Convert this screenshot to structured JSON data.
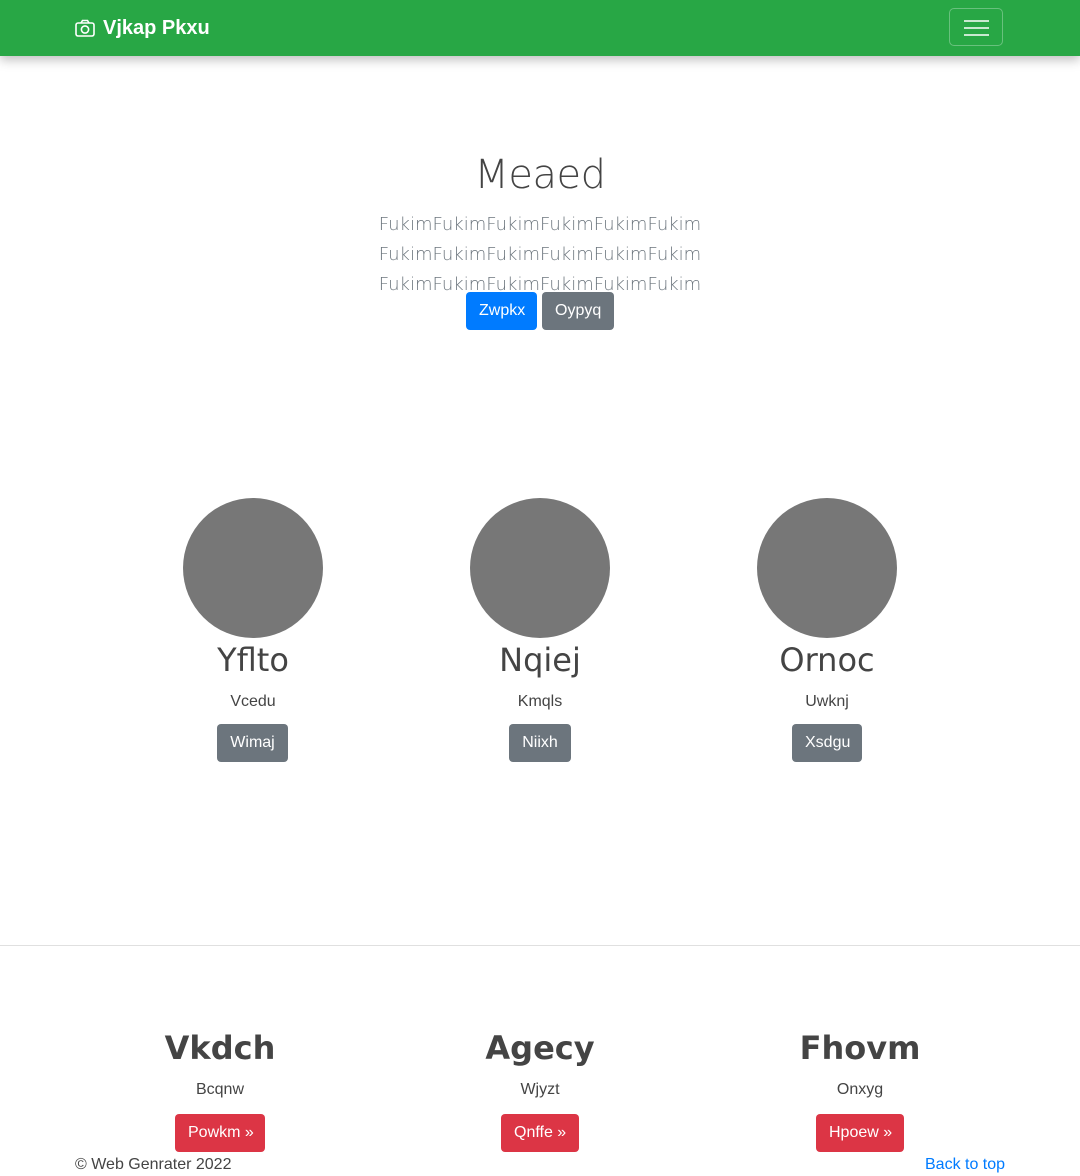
{
  "navbar": {
    "brand": "Vjkap Pkxu",
    "brand_icon": "camera-icon",
    "toggler_icon": "hamburger-icon",
    "color": "#28a745"
  },
  "hero": {
    "title": "Meaed",
    "lead": "FukimFukimFukimFukimFukimFukim FukimFukimFukimFukimFukimFukim FukimFukimFukimFukimFukimFukim",
    "primary_button": "Zwpkx",
    "secondary_button": "Oypyq"
  },
  "profiles": [
    {
      "name": "Yflto",
      "subtitle": "Vcedu",
      "button": "Wimaj"
    },
    {
      "name": "Nqiej",
      "subtitle": "Kmqls",
      "button": "Niixh"
    },
    {
      "name": "Ornoc",
      "subtitle": "Uwknj",
      "button": "Xsdgu"
    }
  ],
  "features": [
    {
      "title": "Vkdch",
      "subtitle": "Bcqnw",
      "button": "Powkm »"
    },
    {
      "title": "Agecy",
      "subtitle": "Wjyzt",
      "button": "Qnffe »"
    },
    {
      "title": "Fhovm",
      "subtitle": "Onxyg",
      "button": "Hpoew »"
    }
  ],
  "footer": {
    "copyright": "© Web Genrater 2022",
    "back_to_top": "Back to top"
  }
}
